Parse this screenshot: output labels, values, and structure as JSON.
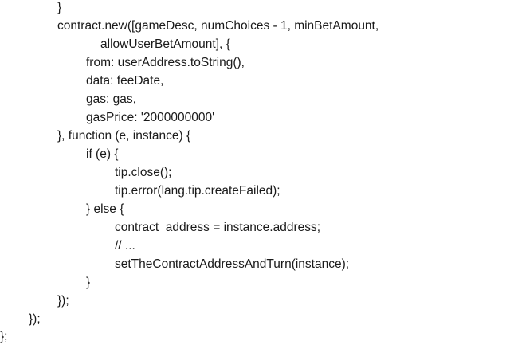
{
  "code_lines": [
    "}",
    "contract.new([gameDesc, numChoices - 1, minBetAmount,",
    "allowUserBetAmount], {",
    "from: userAddress.toString(),",
    "data: feeDate,",
    "gas: gas,",
    "gasPrice: '2000000000'",
    "}, function (e, instance) {",
    "if (e) {",
    "tip.close();",
    "tip.error(lang.tip.createFailed);",
    "} else {",
    "contract_address = instance.address;",
    "// ...",
    "setTheContractAddressAndTurn(instance);",
    "}",
    "});",
    "});",
    "};"
  ]
}
